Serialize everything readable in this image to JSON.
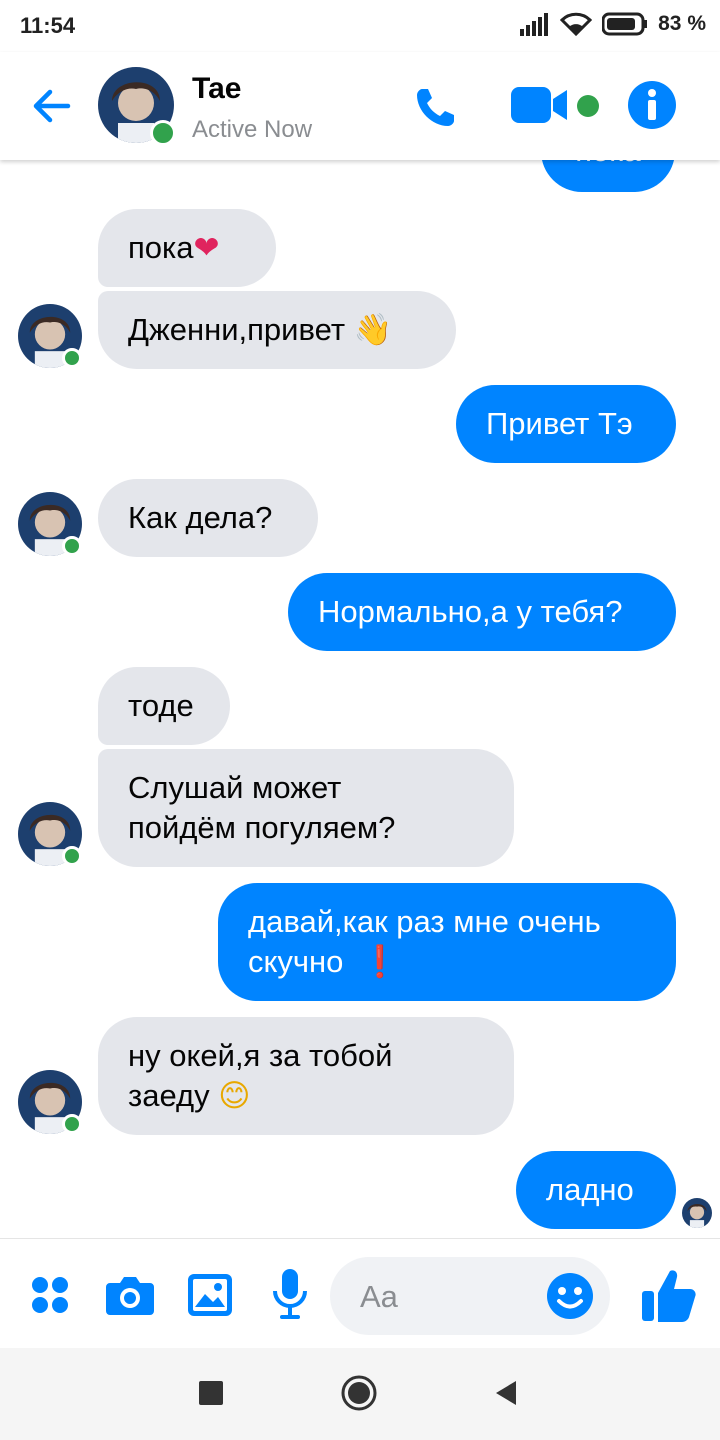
{
  "status_bar": {
    "time": "11:54",
    "battery": "83 %"
  },
  "header": {
    "name": "Tae",
    "status": "Active Now"
  },
  "colors": {
    "accent": "#0084ff",
    "incoming": "#e4e6eb",
    "online": "#31a24c"
  },
  "messages": [
    {
      "dir": "out",
      "text": "пока",
      "partial": true
    },
    {
      "dir": "in",
      "text": "пока",
      "emoji": "❤"
    },
    {
      "dir": "in",
      "text": "Дженни,привет",
      "emoji": "👋"
    },
    {
      "dir": "out",
      "text": "Привет Тэ"
    },
    {
      "dir": "in",
      "text": "Как дела?"
    },
    {
      "dir": "out",
      "text": "Нормально,а у тебя?"
    },
    {
      "dir": "in",
      "text": "тоде"
    },
    {
      "dir": "in",
      "line1": "Слушай может",
      "line2": "пойдём погуляем?"
    },
    {
      "dir": "out",
      "line1": "давай,как раз мне очень",
      "line2": "скучно",
      "emoji": "❗"
    },
    {
      "dir": "in",
      "line1": "ну окей,я за тобой",
      "line2": "заеду",
      "emoji": "😊"
    },
    {
      "dir": "out",
      "text": "ладно"
    }
  ],
  "composer": {
    "placeholder": "Aa"
  },
  "icons": [
    "back-arrow-icon",
    "phone-icon",
    "video-camera-icon",
    "info-icon",
    "apps-grid-icon",
    "camera-icon",
    "gallery-icon",
    "microphone-icon",
    "smiley-icon",
    "thumbs-up-icon",
    "nav-square-icon",
    "nav-circle-icon",
    "nav-back-icon"
  ]
}
